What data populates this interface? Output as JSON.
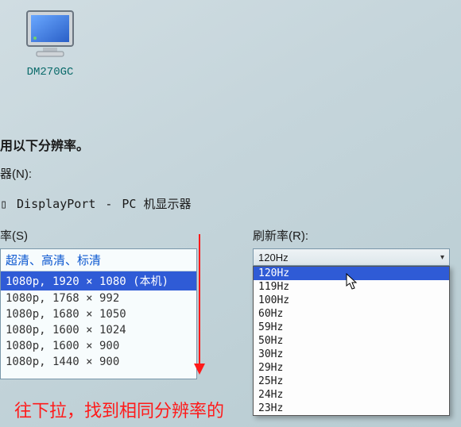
{
  "desktop": {
    "icon_label": "DM270GC"
  },
  "headings": {
    "use_resolution": "用以下分辨率。",
    "monitor_n": "器(N):",
    "rate_s": "率(S)",
    "refresh_r": "刷新率(R):"
  },
  "connector": {
    "port": "DisplayPort",
    "dash": "-",
    "device": "PC 机显示器"
  },
  "resolution": {
    "header": "超清、高清、标清",
    "items": [
      {
        "label": "1080p, 1920 × 1080 (本机)",
        "selected": true
      },
      {
        "label": "1080p, 1768 × 992",
        "selected": false
      },
      {
        "label": "1080p, 1680 × 1050",
        "selected": false
      },
      {
        "label": "1080p, 1600 × 1024",
        "selected": false
      },
      {
        "label": "1080p, 1600 × 900",
        "selected": false
      },
      {
        "label": "1080p, 1440 × 900",
        "selected": false
      }
    ]
  },
  "refresh": {
    "selected": "120Hz",
    "options": [
      {
        "label": "120Hz",
        "selected": true
      },
      {
        "label": "119Hz",
        "selected": false
      },
      {
        "label": "100Hz",
        "selected": false
      },
      {
        "label": "60Hz",
        "selected": false
      },
      {
        "label": "59Hz",
        "selected": false
      },
      {
        "label": "50Hz",
        "selected": false
      },
      {
        "label": "30Hz",
        "selected": false
      },
      {
        "label": "29Hz",
        "selected": false
      },
      {
        "label": "25Hz",
        "selected": false
      },
      {
        "label": "24Hz",
        "selected": false
      },
      {
        "label": "23Hz",
        "selected": false
      }
    ]
  },
  "annotation": {
    "text": "往下拉，找到相同分辨率的"
  }
}
